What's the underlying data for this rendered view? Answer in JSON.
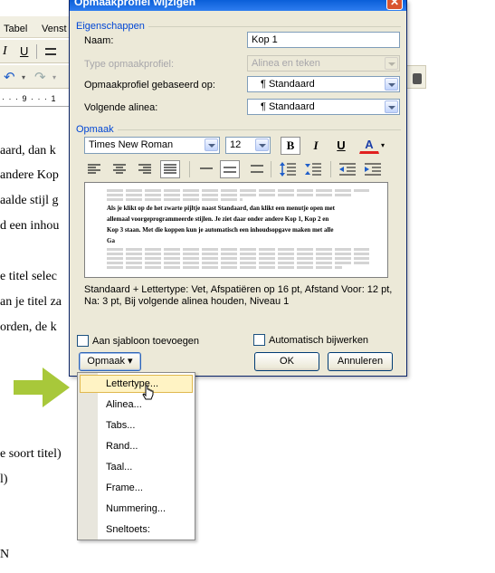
{
  "background": {
    "menu": [
      "Tabel",
      "Venst"
    ],
    "ruler": "· · · 9 · · · 1",
    "doc_lines": [
      "aard, dan k",
      "andere Kop",
      "aalde stijl g",
      "d een inhou",
      "e titel selec",
      "an je titel za",
      "orden, de k",
      "e soort titel)",
      "l)",
      "N"
    ]
  },
  "dialog": {
    "title": "Opmaakprofiel wijzigen",
    "close": "✕",
    "group_properties": "Eigenschappen",
    "name_label": "Naam:",
    "name_value": "Kop 1",
    "type_label": "Type opmaakprofiel:",
    "type_value": "Alinea en teken",
    "based_label": "Opmaakprofiel gebaseerd op:",
    "based_value": "¶ Standaard",
    "next_label": "Volgende alinea:",
    "next_value": "¶ Standaard",
    "group_format": "Opmaak",
    "font_value": "Times New Roman",
    "size_value": "12",
    "bold": "B",
    "italic": "I",
    "underline": "U",
    "fontcolor": "A",
    "preview_lines": [
      "Als je klikt op de het zwarte pijltje naast Standaard, dan klikt een menutje open met",
      "allemaal voorgeprogrammeerde stijlen. Je ziet daar onder andere Kop 1, Kop 2 en",
      "Kop 3 staan. Met die koppen kun je automatisch een inhoudsopgave maken met alle",
      "Ga"
    ],
    "description": "Standaard + Lettertype: Vet, Afspatiëren op 16 pt, Afstand Voor:  12 pt, Na:  3 pt, Bij volgende alinea houden, Niveau 1",
    "add_template_label": "Aan sjabloon toevoegen",
    "auto_update_label": "Automatisch bijwerken",
    "format_button": "Opmaak ▾",
    "ok_button": "OK",
    "cancel_button": "Annuleren"
  },
  "menu": {
    "items": [
      "Lettertype...",
      "Alinea...",
      "Tabs...",
      "Rand...",
      "Taal...",
      "Frame...",
      "Nummering...",
      "Sneltoets:"
    ]
  },
  "colors": {
    "accent": "#0046d5",
    "arrow": "#a8c83a",
    "highlight": "#fff3c4"
  }
}
